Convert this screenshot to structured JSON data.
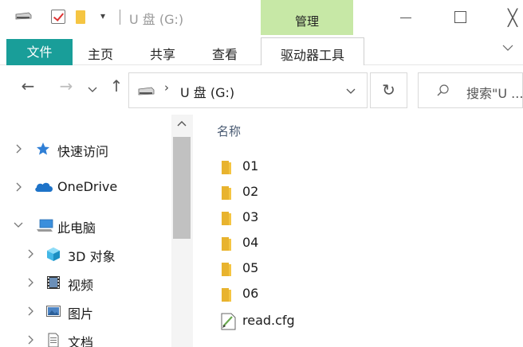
{
  "window": {
    "title": "U 盘 (G:)",
    "manage_tab": "管理",
    "minimize": "—",
    "maximize": "□",
    "close": "╳"
  },
  "ribbon": {
    "tabs": [
      "文件",
      "主页",
      "共享",
      "查看",
      "驱动器工具"
    ]
  },
  "address": {
    "back": "←",
    "forward": "→",
    "recent": "⌄",
    "up": "↑",
    "separator": "›",
    "path": "U 盘 (G:)",
    "refresh": "↻",
    "search_placeholder": "搜索\"U ..."
  },
  "nav": {
    "items": [
      {
        "label": "快速访问",
        "icon": "star-icon",
        "level": 0,
        "expanded": false
      },
      {
        "label": "OneDrive",
        "icon": "cloud-icon",
        "level": 0,
        "expanded": false
      },
      {
        "label": "此电脑",
        "icon": "computer-icon",
        "level": 0,
        "expanded": true
      },
      {
        "label": "3D 对象",
        "icon": "3d-objects-icon",
        "level": 1,
        "expanded": false
      },
      {
        "label": "视频",
        "icon": "video-icon",
        "level": 1,
        "expanded": false
      },
      {
        "label": "图片",
        "icon": "pictures-icon",
        "level": 1,
        "expanded": false
      },
      {
        "label": "文档",
        "icon": "documents-icon",
        "level": 1,
        "expanded": false
      }
    ]
  },
  "content": {
    "column_header": "名称",
    "files": [
      {
        "name": "01",
        "type": "folder"
      },
      {
        "name": "02",
        "type": "folder"
      },
      {
        "name": "03",
        "type": "folder"
      },
      {
        "name": "04",
        "type": "folder"
      },
      {
        "name": "05",
        "type": "folder"
      },
      {
        "name": "06",
        "type": "folder"
      },
      {
        "name": "read.cfg",
        "type": "cfg"
      }
    ]
  },
  "colors": {
    "file_tab": "#199e99",
    "manage_tab": "#c7e8a6",
    "folder": "#f5c542",
    "header_text": "#4a5b73"
  }
}
